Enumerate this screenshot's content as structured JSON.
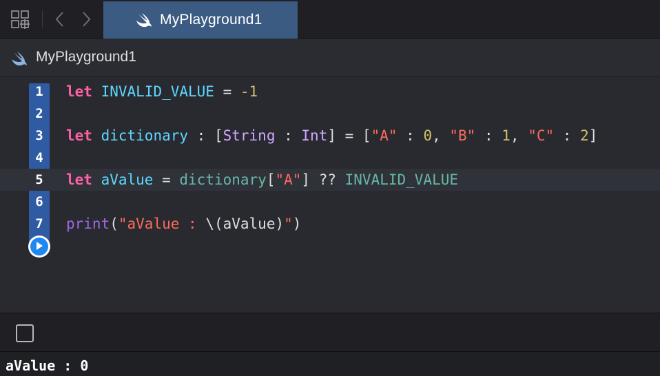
{
  "tab": {
    "label": "MyPlayground1",
    "icon": "swift-icon"
  },
  "breadcrumb": {
    "label": "MyPlayground1",
    "icon": "swift-icon"
  },
  "toolbar_icons": [
    "grid-icon",
    "back-arrow-icon",
    "forward-arrow-icon"
  ],
  "editor": {
    "highlighted_line": 5,
    "lines": [
      {
        "number": "1",
        "tokens": [
          [
            "kw",
            "let"
          ],
          [
            "pl",
            " "
          ],
          [
            "id1",
            "INVALID_VALUE"
          ],
          [
            "pl",
            " = "
          ],
          [
            "nm",
            "-1"
          ]
        ]
      },
      {
        "number": "2",
        "tokens": []
      },
      {
        "number": "3",
        "tokens": [
          [
            "kw",
            "let"
          ],
          [
            "pl",
            " "
          ],
          [
            "id1",
            "dictionary"
          ],
          [
            "pl",
            " : ["
          ],
          [
            "ty",
            "String"
          ],
          [
            "pl",
            " : "
          ],
          [
            "ty",
            "Int"
          ],
          [
            "pl",
            "] = ["
          ],
          [
            "st",
            "\"A\""
          ],
          [
            "pl",
            " : "
          ],
          [
            "nm",
            "0"
          ],
          [
            "pl",
            ", "
          ],
          [
            "st",
            "\"B\""
          ],
          [
            "pl",
            " : "
          ],
          [
            "nm",
            "1"
          ],
          [
            "pl",
            ", "
          ],
          [
            "st",
            "\"C\""
          ],
          [
            "pl",
            " : "
          ],
          [
            "nm",
            "2"
          ],
          [
            "pl",
            "]"
          ]
        ]
      },
      {
        "number": "4",
        "tokens": []
      },
      {
        "number": "5",
        "tokens": [
          [
            "kw",
            "let"
          ],
          [
            "pl",
            " "
          ],
          [
            "id1",
            "aValue"
          ],
          [
            "pl",
            " = "
          ],
          [
            "id2",
            "dictionary"
          ],
          [
            "pl",
            "["
          ],
          [
            "st",
            "\"A\""
          ],
          [
            "pl",
            "] ?? "
          ],
          [
            "id2",
            "INVALID_VALUE"
          ]
        ]
      },
      {
        "number": "6",
        "tokens": []
      },
      {
        "number": "7",
        "tokens": [
          [
            "fn",
            "print"
          ],
          [
            "pl",
            "("
          ],
          [
            "st",
            "\"aValue : "
          ],
          [
            "pl",
            "\\("
          ],
          [
            "pl",
            "aValue"
          ],
          [
            "pl",
            ")"
          ],
          [
            "st",
            "\""
          ],
          [
            "pl",
            ")"
          ]
        ]
      }
    ]
  },
  "run_button": {
    "icon": "play-icon"
  },
  "debug": {
    "toggle_icon": "console-toggle-icon"
  },
  "console": {
    "output": "aValue : 0"
  },
  "colors": {
    "keyword": "#fc5fa3",
    "identifier": "#5dd8ff",
    "other_identifier": "#67b7a4",
    "type": "#d0a8ff",
    "string": "#fc6a5d",
    "number": "#d0bf69",
    "function": "#a167e6",
    "tab_active": "#3b5b82",
    "gutter": "#2f5ba3"
  }
}
